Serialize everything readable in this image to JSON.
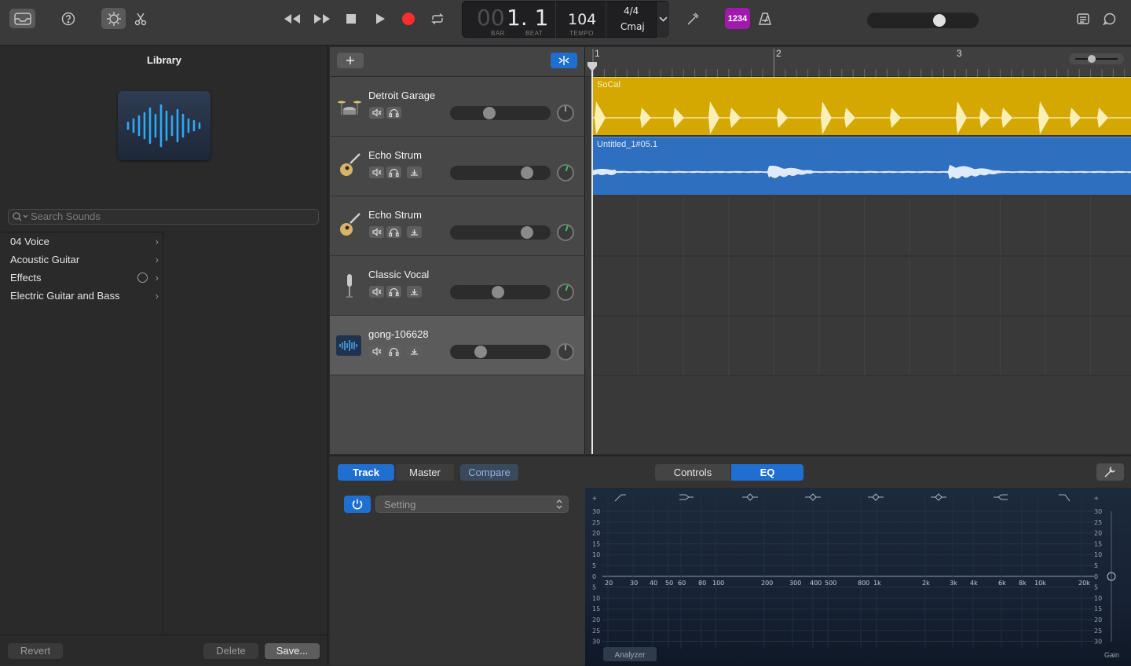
{
  "toolbar": {
    "lcd": {
      "bar": "00",
      "bar_beat": "1. 1",
      "bar_label": "BAR",
      "beat_label": "BEAT",
      "tempo": "104",
      "tempo_label": "TEMPO",
      "signature": "4/4",
      "key": "Cmaj"
    },
    "count_in_label": "1234",
    "master_volume_fraction": 0.68,
    "icons": [
      "library-icon",
      "quick-help-icon",
      "smart-controls-icon",
      "scissors-icon",
      "rewind-icon",
      "forward-icon",
      "stop-icon",
      "play-icon",
      "record-icon",
      "cycle-icon",
      "tuner-icon",
      "count-in-icon",
      "metronome-icon",
      "notepad-icon",
      "loop-browser-icon"
    ]
  },
  "library": {
    "title": "Library",
    "search_placeholder": "Search Sounds",
    "categories": [
      {
        "label": "04 Voice",
        "download": false
      },
      {
        "label": "Acoustic Guitar",
        "download": false
      },
      {
        "label": "Effects",
        "download": true
      },
      {
        "label": "Electric Guitar and Bass",
        "download": false
      }
    ],
    "footer": {
      "revert": "Revert",
      "delete": "Delete",
      "save": "Save..."
    }
  },
  "tracks": [
    {
      "name": "Detroit Garage",
      "icon": "drum-kit-icon",
      "volume": 0.38,
      "pan_color": "#9a9a9a",
      "has_input": false,
      "selected": false
    },
    {
      "name": "Echo Strum",
      "icon": "acoustic-guitar-icon",
      "volume": 0.82,
      "pan_color": "#35c45a",
      "has_input": true,
      "selected": false
    },
    {
      "name": "Echo Strum",
      "icon": "acoustic-guitar-icon",
      "volume": 0.82,
      "pan_color": "#35c45a",
      "has_input": true,
      "selected": false
    },
    {
      "name": "Classic Vocal",
      "icon": "microphone-icon",
      "volume": 0.48,
      "pan_color": "#35c45a",
      "has_input": true,
      "selected": false
    },
    {
      "name": "gong-106628",
      "icon": "audio-waveform-icon",
      "volume": 0.28,
      "pan_color": "#9a9a9a",
      "has_input": true,
      "selected": true
    }
  ],
  "timeline": {
    "bars": [
      "1",
      "2",
      "3"
    ],
    "regions": [
      {
        "label": "SoCal",
        "color": "#d4a800",
        "type": "drummer"
      },
      {
        "label": "Untitled_1#05.1",
        "color": "#2f6fbf",
        "type": "audio"
      }
    ]
  },
  "editor": {
    "tabs": [
      "Track",
      "Master",
      "Compare"
    ],
    "view_tabs": [
      "Controls",
      "EQ"
    ],
    "setting_label": "Setting",
    "eq": {
      "db_left": [
        "30",
        "25",
        "20",
        "15",
        "10",
        "5",
        "0",
        "5",
        "10",
        "15",
        "20",
        "25",
        "30"
      ],
      "db_right": [
        "30",
        "25",
        "20",
        "15",
        "10",
        "5",
        "0",
        "5",
        "10",
        "15",
        "20",
        "25",
        "30"
      ],
      "freqs": [
        "20",
        "30",
        "40",
        "50",
        "60",
        "80",
        "100",
        "200",
        "300",
        "400",
        "500",
        "800",
        "1k",
        "2k",
        "3k",
        "4k",
        "6k",
        "8k",
        "10k",
        "20k"
      ],
      "analyzer_label": "Analyzer",
      "gain_label": "Gain"
    }
  },
  "colors": {
    "accent_blue": "#1f6fd1",
    "record_red": "#ff2d2d",
    "count_in_purple": "#a219b0",
    "drummer_yellow": "#d4a800",
    "audio_blue": "#2f6fbf"
  }
}
